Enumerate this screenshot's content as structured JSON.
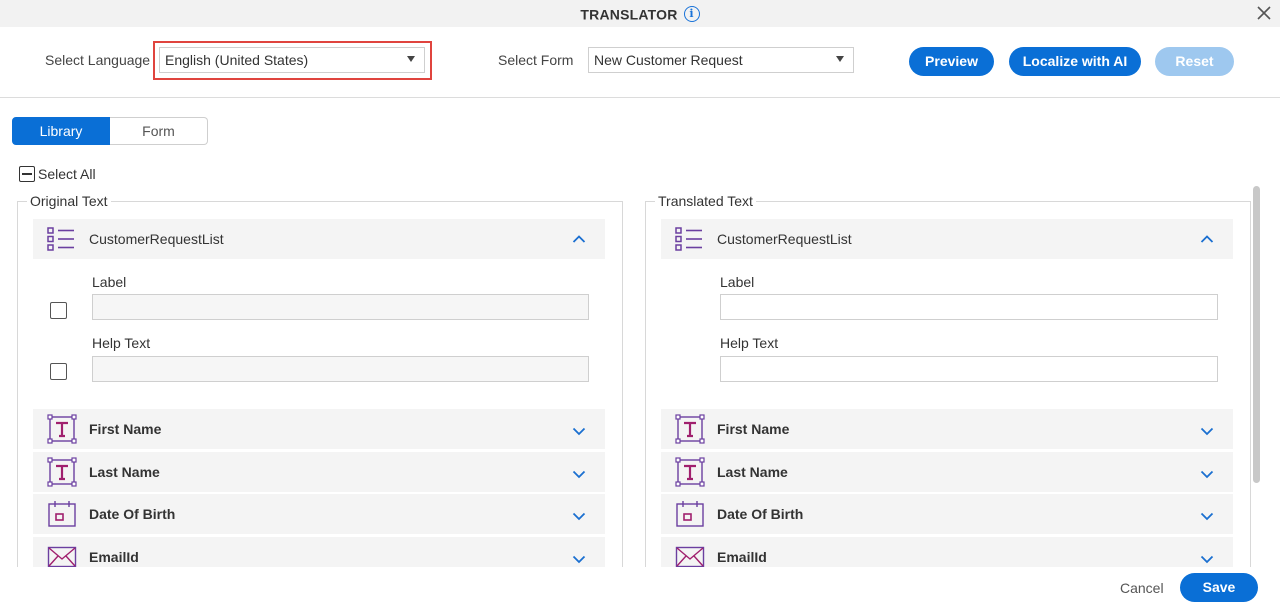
{
  "window": {
    "title": "TRANSLATOR"
  },
  "toolbar": {
    "language_label": "Select Language",
    "language_value": "English (United States)",
    "form_label": "Select Form",
    "form_value": "New Customer Request",
    "preview_label": "Preview",
    "localize_label": "Localize with AI",
    "reset_label": "Reset"
  },
  "tabs": [
    {
      "label": "Library",
      "active": true
    },
    {
      "label": "Form",
      "active": false
    }
  ],
  "select_all_label": "Select All",
  "original": {
    "legend": "Original Text",
    "group": {
      "name": "CustomerRequestList",
      "label_field": "Label",
      "help_field": "Help Text"
    },
    "rows": [
      {
        "name": "First Name",
        "icon": "text-field-icon"
      },
      {
        "name": "Last Name",
        "icon": "text-field-icon"
      },
      {
        "name": "Date Of Birth",
        "icon": "calendar-icon"
      },
      {
        "name": "EmailId",
        "icon": "email-icon"
      }
    ]
  },
  "translated": {
    "legend": "Translated Text",
    "group": {
      "name": "CustomerRequestList",
      "label_field": "Label",
      "help_field": "Help Text"
    },
    "rows": [
      {
        "name": "First Name",
        "icon": "text-field-icon"
      },
      {
        "name": "Last Name",
        "icon": "text-field-icon"
      },
      {
        "name": "Date Of Birth",
        "icon": "calendar-icon"
      },
      {
        "name": "EmailId",
        "icon": "email-icon"
      }
    ]
  },
  "footer": {
    "cancel_label": "Cancel",
    "save_label": "Save"
  },
  "colors": {
    "primary": "#0a6fd6",
    "disabled": "#9ec8ef",
    "highlight": "#e0443e",
    "icon_purple": "#6b3fa0",
    "icon_magenta": "#a0206e"
  }
}
